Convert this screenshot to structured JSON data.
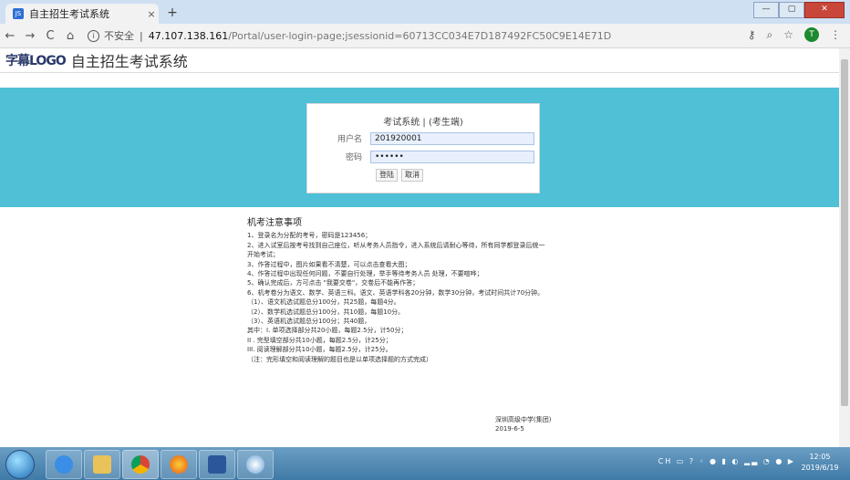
{
  "browser": {
    "tab_title": "自主招生考试系统",
    "favicon_text": "JS",
    "tab_close": "×",
    "new_tab": "+",
    "win_minimize": "—",
    "win_maximize": "▢",
    "win_close": "✕",
    "nav_back": "←",
    "nav_forward": "→",
    "nav_reload": "C",
    "nav_home": "⌂",
    "info_icon": "i",
    "insecure_label": "不安全",
    "separator": "|",
    "url_host": "47.107.138.161",
    "url_path": "/Portal/user-login-page;jsessionid=60713CC034E7D187492FC50C9E14E71D",
    "key_icon": "⚷",
    "zoom_icon": "⌕",
    "star_icon": "☆",
    "ext_icon": "T",
    "menu_icon": "⋮"
  },
  "header": {
    "logo": "字幕LOGO",
    "system_title": "自主招生考试系统"
  },
  "login": {
    "title": "考试系统 | (考生端)",
    "username_label": "用户名",
    "username_value": "201920001",
    "password_label": "密码",
    "password_value": "••••••",
    "login_button": "登陆",
    "cancel_button": "取消"
  },
  "notice": {
    "title": "机考注意事项",
    "lines": [
      "1、登录名为分配的考号，密码是123456；",
      "2、进入试室后按考号找到自己座位，听从考务人员指令，进入系统后请耐心等待，所有同学都登录后统一",
      "开始考试；",
      "3、作答过程中，图片如果看不清楚，可以点击查看大图；",
      "4、作答过程中出现任何问题，不要自行处理，举手等待考务人员 处理，不要喧哗；",
      "5、确认完成后，方可点击 \"我要交卷\"，交卷后不能再作答；",
      "6、机考卷分为语文、数学、英语三科。语文、英语学科各20分钟，数学30分钟，考试时间共计70分钟。",
      "（1）、语文机选试题总分100分，共25题，每题4分。",
      "（2）、数学机选试题总分100分，共10题，每题10分。",
      "（3）、英语机选试题总分100分；共40题，",
      "其中：I. 单项选择部分共20小题，每题2.5分，计50分；",
      "II . 完型填空部分共10小题，每题2.5分，计25分；",
      "III. 阅读理解部分共10小题，每题2.5分，计25分。",
      "（注：完形填空和阅读理解的题目也是以单项选择题的方式完成）"
    ],
    "org": "深圳高级中学(集团)",
    "date": "2019-6-5"
  },
  "taskbar": {
    "tray_text": "CH ▭ ? ◦ ● ▮ ◐ ▂▃ ◔ ● ▶",
    "time": "12:05",
    "date": "2019/6/19"
  },
  "colors": {
    "band": "#4fc0d6",
    "input_bg": "#e8f0fe",
    "input_border": "#a9c3e4"
  }
}
